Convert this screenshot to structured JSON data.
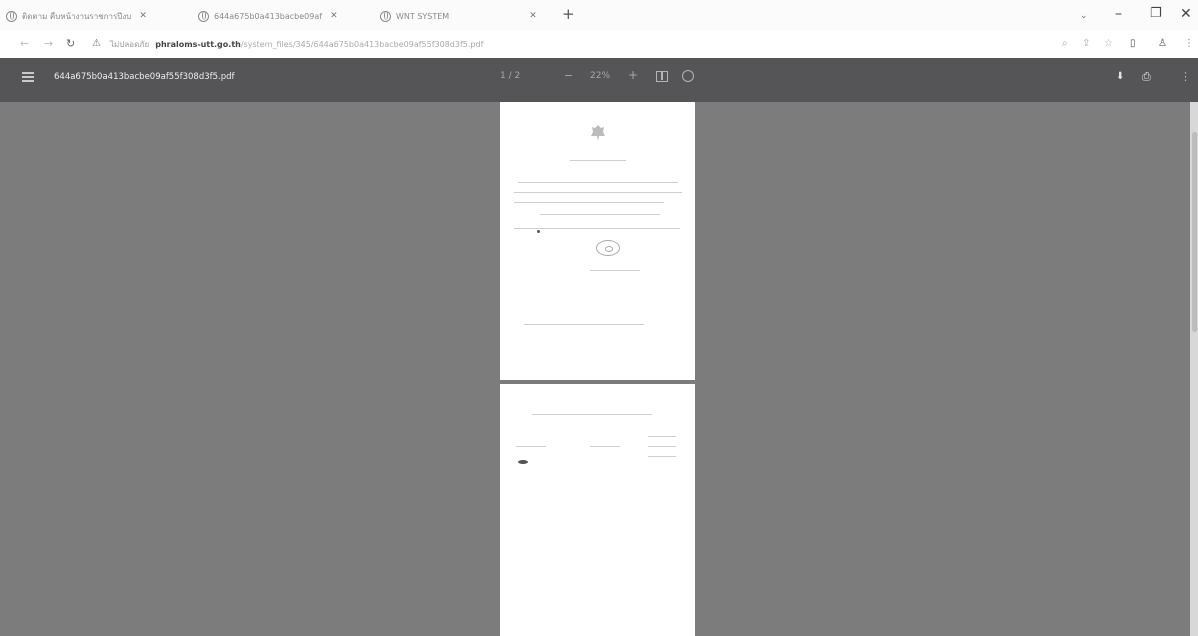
{
  "browser": {
    "tabs": [
      {
        "label": "ติดตาม คืบหน้างานราชการปีงบ"
      },
      {
        "label": "644a675b0a413bacbe09af"
      },
      {
        "label": "WNT SYSTEM"
      }
    ],
    "new_tab": "+",
    "window_controls": {
      "chevron": "⌄",
      "minimize": "–",
      "maximize": "❐",
      "close": "✕"
    },
    "address": {
      "security_text": "ไม่ปลอดภัย",
      "host": "phraloms-utt.go.th",
      "path": "/system_files/345/644a675b0a413bacbe09af55f308d3f5.pdf"
    }
  },
  "pdf_viewer": {
    "file_name": "644a675b0a413bacbe09af55f308d3f5.pdf",
    "page_indicator": "1 / 2",
    "zoom": "22%",
    "minus": "−",
    "plus": "+"
  },
  "icons": {
    "back": "arrow-left-icon",
    "forward": "arrow-right-icon",
    "reload": "reload-icon",
    "menu": "menu-icon",
    "download": "download-icon",
    "print": "print-icon",
    "more": "more-vertical-icon"
  }
}
